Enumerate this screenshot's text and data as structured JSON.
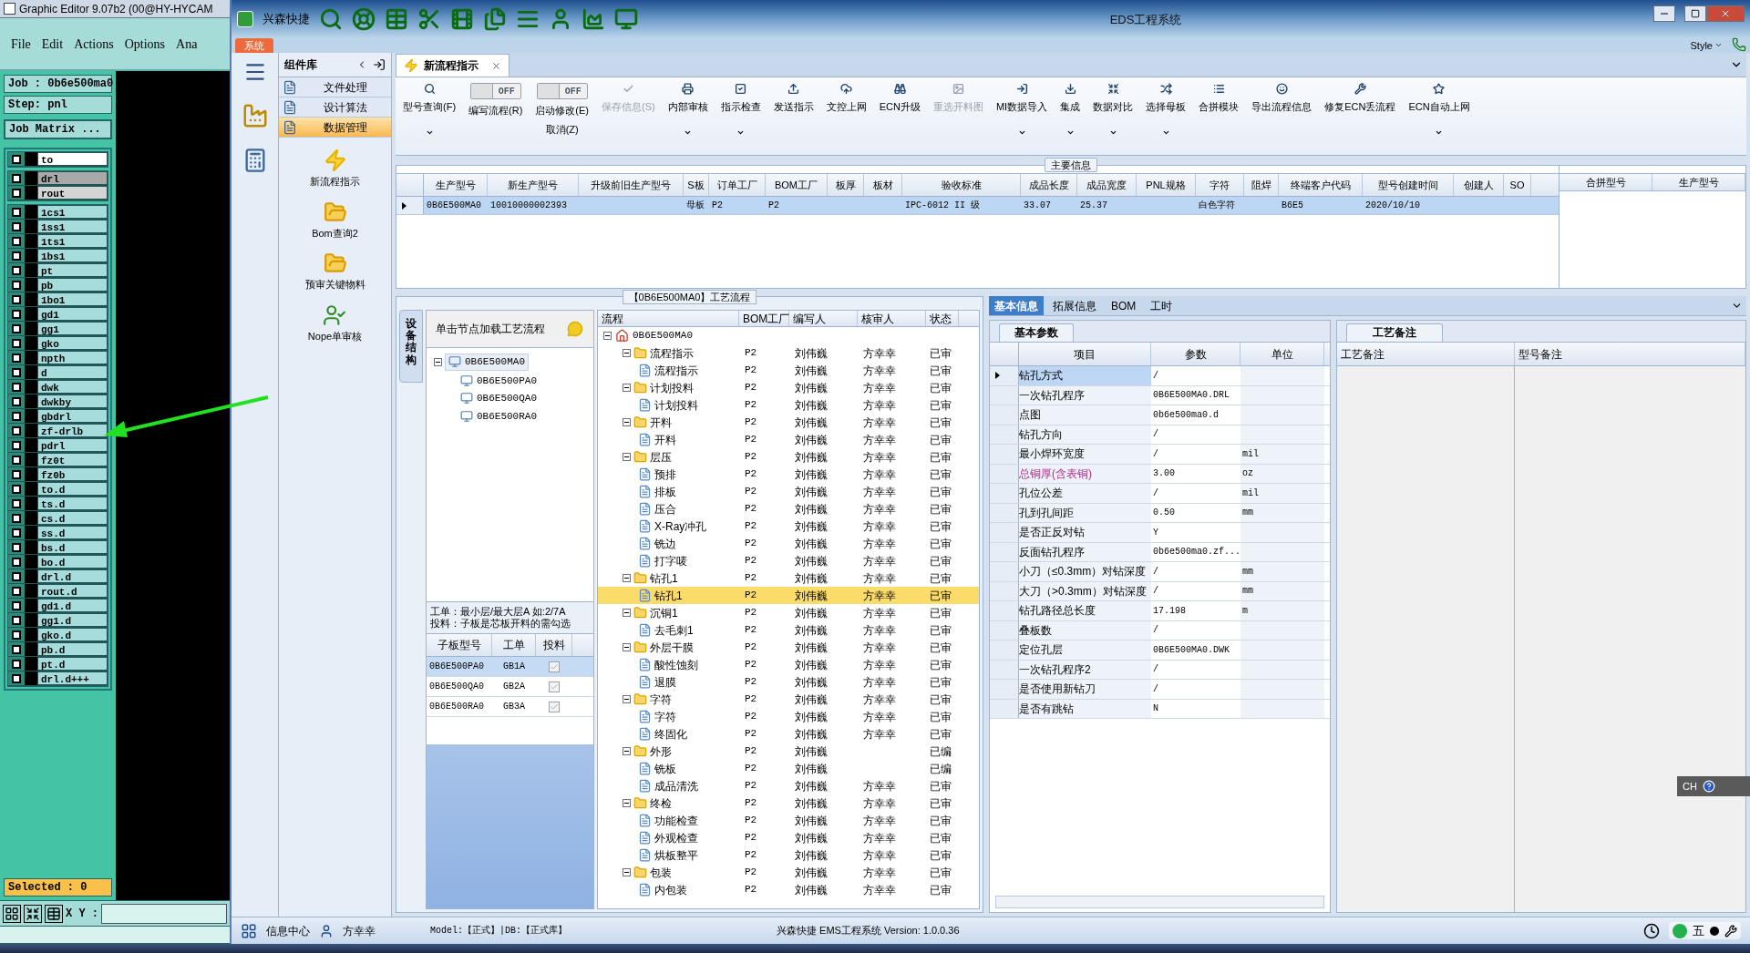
{
  "graphic_editor": {
    "title": "Graphic Editor 9.07b2 (00@HY-HYCAM",
    "menu": [
      "File",
      "Edit",
      "Actions",
      "Options",
      "Ana"
    ],
    "job": "Job : 0b6e500ma0",
    "step": "Step: pnl",
    "job_matrix_button": "Job Matrix ...",
    "layer_groups": [
      [
        {
          "name": "to",
          "color": "#ffffff",
          "checked": false
        }
      ],
      [
        {
          "name": "drl",
          "color": "#a9a9a9",
          "checked": false
        },
        {
          "name": "rout",
          "color": "#d4d4d4",
          "checked": false
        }
      ],
      [
        {
          "name": "1cs1",
          "color": "#a6dcdc",
          "checked": false
        },
        {
          "name": "1ss1",
          "color": "#a6dcdc",
          "checked": false
        },
        {
          "name": "1ts1",
          "color": "#a6dcdc",
          "checked": false
        },
        {
          "name": "1bs1",
          "color": "#a6dcdc",
          "checked": false
        },
        {
          "name": "pt",
          "color": "#a6dcdc",
          "checked": false
        },
        {
          "name": "pb",
          "color": "#a6dcdc",
          "checked": false
        },
        {
          "name": "1bo1",
          "color": "#a6dcdc",
          "checked": false
        },
        {
          "name": "gd1",
          "color": "#a6dcdc",
          "checked": false
        },
        {
          "name": "gg1",
          "color": "#a6dcdc",
          "checked": false
        },
        {
          "name": "gko",
          "color": "#a6dcdc",
          "checked": false
        },
        {
          "name": "npth",
          "color": "#a6dcdc",
          "checked": false
        },
        {
          "name": "d",
          "color": "#a6dcdc",
          "checked": false
        },
        {
          "name": "dwk",
          "color": "#a6dcdc",
          "checked": false
        },
        {
          "name": "dwkby",
          "color": "#a6dcdc",
          "checked": false
        },
        {
          "name": "gbdrl",
          "color": "#a6dcdc",
          "checked": false
        },
        {
          "name": "zf-drlb",
          "color": "#a6dcdc",
          "checked": false
        },
        {
          "name": "pdrl",
          "color": "#a6dcdc",
          "checked": false
        },
        {
          "name": "fz0t",
          "color": "#a6dcdc",
          "checked": false
        },
        {
          "name": "fz0b",
          "color": "#a6dcdc",
          "checked": false
        },
        {
          "name": "to.d",
          "color": "#a6dcdc",
          "checked": false
        },
        {
          "name": "ts.d",
          "color": "#a6dcdc",
          "checked": false
        },
        {
          "name": "cs.d",
          "color": "#a6dcdc",
          "checked": false
        },
        {
          "name": "ss.d",
          "color": "#a6dcdc",
          "checked": false
        },
        {
          "name": "bs.d",
          "color": "#a6dcdc",
          "checked": false
        },
        {
          "name": "bo.d",
          "color": "#a6dcdc",
          "checked": false
        },
        {
          "name": "drl.d",
          "color": "#a6dcdc",
          "checked": false
        },
        {
          "name": "rout.d",
          "color": "#a6dcdc",
          "checked": false
        },
        {
          "name": "gd1.d",
          "color": "#a6dcdc",
          "checked": false
        },
        {
          "name": "gg1.d",
          "color": "#a6dcdc",
          "checked": false
        },
        {
          "name": "gko.d",
          "color": "#a6dcdc",
          "checked": false
        },
        {
          "name": "pb.d",
          "color": "#a6dcdc",
          "checked": false
        },
        {
          "name": "pt.d",
          "color": "#a6dcdc",
          "checked": false
        },
        {
          "name": "drl.d+++",
          "color": "#a6dcdc",
          "checked": false
        }
      ]
    ],
    "selected": "Selected : 0",
    "xy_label": "X Y :"
  },
  "eds": {
    "app_name": "兴森快捷",
    "title": "EDS工程系统",
    "menu_tab": "系统",
    "style_menu": "Style",
    "sidebar": {
      "title": "组件库",
      "items": [
        {
          "label": "文件处理",
          "selected": false
        },
        {
          "label": "设计算法",
          "selected": false
        },
        {
          "label": "数据管理",
          "selected": true
        }
      ],
      "tools": [
        "新流程指示",
        "Bom查询2",
        "预审关键物料",
        "Nope单审核"
      ]
    },
    "doc_tab": "新流程指示",
    "ribbon": [
      {
        "kind": "button",
        "label": "型号查询(F)",
        "disabled": false,
        "dropdown": true
      },
      {
        "kind": "toggle",
        "label": "编写流程(R)",
        "toggle_text": "OFF",
        "on": false
      },
      {
        "kind": "toggle",
        "label": "启动修改(E)",
        "sub_label": "取消(Z)",
        "toggle_text": "OFF",
        "on": false
      },
      {
        "kind": "button",
        "label": "保存信息(S)",
        "disabled": true,
        "dropdown": false
      },
      {
        "kind": "button",
        "label": "内部审核",
        "disabled": false,
        "dropdown": true
      },
      {
        "kind": "button",
        "label": "指示检查",
        "disabled": false,
        "dropdown": true
      },
      {
        "kind": "button",
        "label": "发送指示",
        "disabled": false,
        "dropdown": false
      },
      {
        "kind": "button",
        "label": "文控上网",
        "disabled": false,
        "dropdown": false
      },
      {
        "kind": "button",
        "label": "ECN升级",
        "disabled": false,
        "dropdown": false
      },
      {
        "kind": "button",
        "label": "重选开料图",
        "disabled": true,
        "dropdown": false
      },
      {
        "kind": "button",
        "label": "MI数据导入",
        "disabled": false,
        "dropdown": true
      },
      {
        "kind": "button",
        "label": "集成",
        "disabled": false,
        "dropdown": true
      },
      {
        "kind": "button",
        "label": "数据对比",
        "disabled": false,
        "dropdown": true
      },
      {
        "kind": "button",
        "label": "选择母板",
        "disabled": false,
        "dropdown": true
      },
      {
        "kind": "button",
        "label": "合拼模块",
        "disabled": false,
        "dropdown": false
      },
      {
        "kind": "button",
        "label": "导出流程信息",
        "disabled": false,
        "dropdown": false
      },
      {
        "kind": "button",
        "label": "修复ECN丢流程",
        "disabled": false,
        "dropdown": false
      },
      {
        "kind": "button",
        "label": "ECN自动上网",
        "disabled": false,
        "dropdown": true
      }
    ],
    "main_info": {
      "title": "主要信息",
      "columns": [
        "生产型号",
        "新生产型号",
        "升级前旧生产型号",
        "S板",
        "订单工厂",
        "BOM工厂",
        "板厚",
        "板材",
        "验收标准",
        "成品长度",
        "成品宽度",
        "PNL规格",
        "字符",
        "阻焊",
        "终端客户代码",
        "型号创建时间",
        "创建人",
        "SO"
      ],
      "rows": [
        {
          "selected": true,
          "cells": [
            "0B6E500MA0",
            "10010000002393",
            null,
            "母板",
            "P2",
            "P2",
            null,
            null,
            "IPC-6012 II 级",
            "33.07",
            "25.37",
            null,
            "白色字符",
            null,
            "B6E5",
            "2020/10/10",
            null,
            null
          ]
        }
      ],
      "side_columns": [
        "合拼型号",
        "生产型号"
      ]
    },
    "process": {
      "title": "【0B6E500MA0】工艺流程",
      "side_tab": "设备结构",
      "tree_hint": "单击节点加载工艺流程",
      "structure_tree": {
        "label": "0B6E500MA0",
        "selected": true,
        "expanded": true,
        "children": [
          {
            "label": "0B6E500PA0",
            "selected": false
          },
          {
            "label": "0B6E500QA0",
            "selected": false
          },
          {
            "label": "0B6E500RA0",
            "selected": false
          }
        ]
      },
      "notes": [
        "工单：最小层/最大层A 如:2/7A",
        "投料：子板是芯板开料的需勾选"
      ],
      "sub_boards": {
        "columns": [
          "子板型号",
          "工单",
          "投料"
        ],
        "rows": [
          {
            "model": "0B6E500PA0",
            "order": "GB1A",
            "checked": true,
            "selected": true
          },
          {
            "model": "0B6E500QA0",
            "order": "GB2A",
            "checked": true,
            "selected": false
          },
          {
            "model": "0B6E500RA0",
            "order": "GB3A",
            "checked": true,
            "selected": false
          }
        ]
      },
      "grid_columns": [
        "流程",
        "BOM工厂",
        "编写人",
        "核审人",
        "状态"
      ],
      "root": {
        "label": "0B6E500MA0",
        "expanded": true
      },
      "steps": [
        {
          "name": "流程指示",
          "bom": "P2",
          "writer": "刘伟巍",
          "reviewer": "方幸幸",
          "status": "已审",
          "selected": false,
          "expanded": true,
          "children": [
            {
              "name": "流程指示",
              "bom": "P2",
              "writer": "刘伟巍",
              "reviewer": "方幸幸",
              "status": "已审",
              "selected": false
            }
          ]
        },
        {
          "name": "计划投料",
          "bom": "P2",
          "writer": "刘伟巍",
          "reviewer": "方幸幸",
          "status": "已审",
          "selected": false,
          "expanded": true,
          "children": [
            {
              "name": "计划投料",
              "bom": "P2",
              "writer": "刘伟巍",
              "reviewer": "方幸幸",
              "status": "已审",
              "selected": false
            }
          ]
        },
        {
          "name": "开料",
          "bom": "P2",
          "writer": "刘伟巍",
          "reviewer": "方幸幸",
          "status": "已审",
          "selected": false,
          "expanded": true,
          "children": [
            {
              "name": "开料",
              "bom": "P2",
              "writer": "刘伟巍",
              "reviewer": "方幸幸",
              "status": "已审",
              "selected": false
            }
          ]
        },
        {
          "name": "层压",
          "bom": "P2",
          "writer": "刘伟巍",
          "reviewer": "方幸幸",
          "status": "已审",
          "selected": false,
          "expanded": true,
          "children": [
            {
              "name": "预排",
              "bom": "P2",
              "writer": "刘伟巍",
              "reviewer": "方幸幸",
              "status": "已审",
              "selected": false
            },
            {
              "name": "排板",
              "bom": "P2",
              "writer": "刘伟巍",
              "reviewer": "方幸幸",
              "status": "已审",
              "selected": false
            },
            {
              "name": "压合",
              "bom": "P2",
              "writer": "刘伟巍",
              "reviewer": "方幸幸",
              "status": "已审",
              "selected": false
            },
            {
              "name": "X-Ray冲孔",
              "bom": "P2",
              "writer": "刘伟巍",
              "reviewer": "方幸幸",
              "status": "已审",
              "selected": false
            },
            {
              "name": "铣边",
              "bom": "P2",
              "writer": "刘伟巍",
              "reviewer": "方幸幸",
              "status": "已审",
              "selected": false
            },
            {
              "name": "打字唛",
              "bom": "P2",
              "writer": "刘伟巍",
              "reviewer": "方幸幸",
              "status": "已审",
              "selected": false
            }
          ]
        },
        {
          "name": "钻孔1",
          "bom": "P2",
          "writer": "刘伟巍",
          "reviewer": "方幸幸",
          "status": "已审",
          "selected": false,
          "expanded": true,
          "children": [
            {
              "name": "钻孔1",
              "bom": "P2",
              "writer": "刘伟巍",
              "reviewer": "方幸幸",
              "status": "已审",
              "selected": true
            }
          ]
        },
        {
          "name": "沉铜1",
          "bom": "P2",
          "writer": "刘伟巍",
          "reviewer": "方幸幸",
          "status": "已审",
          "selected": false,
          "expanded": true,
          "children": [
            {
              "name": "去毛刺1",
              "bom": "P2",
              "writer": "刘伟巍",
              "reviewer": "方幸幸",
              "status": "已审",
              "selected": false
            }
          ]
        },
        {
          "name": "外层干膜",
          "bom": "P2",
          "writer": "刘伟巍",
          "reviewer": "方幸幸",
          "status": "已审",
          "selected": false,
          "expanded": true,
          "children": [
            {
              "name": "酸性蚀刻",
              "bom": "P2",
              "writer": "刘伟巍",
              "reviewer": "方幸幸",
              "status": "已审",
              "selected": false
            },
            {
              "name": "退膜",
              "bom": "P2",
              "writer": "刘伟巍",
              "reviewer": "方幸幸",
              "status": "已审",
              "selected": false
            }
          ]
        },
        {
          "name": "字符",
          "bom": "P2",
          "writer": "刘伟巍",
          "reviewer": "方幸幸",
          "status": "已审",
          "selected": false,
          "expanded": true,
          "children": [
            {
              "name": "字符",
              "bom": "P2",
              "writer": "刘伟巍",
              "reviewer": "方幸幸",
              "status": "已审",
              "selected": false
            },
            {
              "name": "终固化",
              "bom": "P2",
              "writer": "刘伟巍",
              "reviewer": "方幸幸",
              "status": "已审",
              "selected": false
            }
          ]
        },
        {
          "name": "外形",
          "bom": "P2",
          "writer": "刘伟巍",
          "status": "已编",
          "selected": false,
          "expanded": true,
          "children": [
            {
              "name": "铣板",
              "bom": "P2",
              "writer": "刘伟巍",
              "status": "已编",
              "selected": false
            },
            {
              "name": "成品清洗",
              "bom": "P2",
              "writer": "刘伟巍",
              "reviewer": "方幸幸",
              "status": "已审",
              "selected": false
            }
          ]
        },
        {
          "name": "终检",
          "bom": "P2",
          "writer": "刘伟巍",
          "reviewer": "方幸幸",
          "status": "已审",
          "selected": false,
          "expanded": true,
          "children": [
            {
              "name": "功能检查",
              "bom": "P2",
              "writer": "刘伟巍",
              "reviewer": "方幸幸",
              "status": "已审",
              "selected": false
            },
            {
              "name": "外观检查",
              "bom": "P2",
              "writer": "刘伟巍",
              "reviewer": "方幸幸",
              "status": "已审",
              "selected": false
            },
            {
              "name": "烘板整平",
              "bom": "P2",
              "writer": "刘伟巍",
              "reviewer": "方幸幸",
              "status": "已审",
              "selected": false
            }
          ]
        },
        {
          "name": "包装",
          "bom": "P2",
          "writer": "刘伟巍",
          "reviewer": "方幸幸",
          "status": "已审",
          "selected": false,
          "expanded": true,
          "children": [
            {
              "name": "内包装",
              "bom": "P2",
              "writer": "刘伟巍",
              "reviewer": "方幸幸",
              "status": "已审",
              "selected": false
            }
          ]
        }
      ]
    },
    "details": {
      "tabs": [
        {
          "label": "基本信息",
          "selected": true
        },
        {
          "label": "拓展信息",
          "selected": false
        },
        {
          "label": "BOM",
          "selected": false
        },
        {
          "label": "工时",
          "selected": false
        }
      ],
      "params_tab": "基本参数",
      "params_columns": [
        "项目",
        "参数",
        "单位"
      ],
      "params": [
        {
          "item": "钻孔方式",
          "value": "/",
          "selected": true,
          "emphasis": false
        },
        {
          "item": "一次钻孔程序",
          "value": "0B6E500MA0.DRL",
          "selected": false,
          "emphasis": false
        },
        {
          "item": "点图",
          "value": "0b6e500ma0.d",
          "selected": false,
          "emphasis": false
        },
        {
          "item": "钻孔方向",
          "value": "/",
          "selected": false,
          "emphasis": false
        },
        {
          "item": "最小焊环宽度",
          "value": "/",
          "unit": "mil",
          "selected": false,
          "emphasis": false
        },
        {
          "item": "总铜厚(含表铜)",
          "value": "3.00",
          "unit": "oz",
          "selected": false,
          "emphasis": true
        },
        {
          "item": "孔位公差",
          "value": "/",
          "unit": "mil",
          "selected": false,
          "emphasis": false
        },
        {
          "item": "孔到孔间距",
          "value": "0.50",
          "unit": "mm",
          "selected": false,
          "emphasis": false
        },
        {
          "item": "是否正反对钻",
          "value": "Y",
          "selected": false,
          "emphasis": false
        },
        {
          "item": "反面钻孔程序",
          "value": "0b6e500ma0.zf...",
          "selected": false,
          "emphasis": false
        },
        {
          "item": "小刀（≤0.3mm）对钻深度",
          "value": "/",
          "unit": "mm",
          "selected": false,
          "emphasis": false
        },
        {
          "item": "大刀（>0.3mm）对钻深度",
          "value": "/",
          "unit": "mm",
          "selected": false,
          "emphasis": false
        },
        {
          "item": "钻孔路径总长度",
          "value": "17.198",
          "unit": "m",
          "selected": false,
          "emphasis": false
        },
        {
          "item": "叠板数",
          "value": "/",
          "selected": false,
          "emphasis": false
        },
        {
          "item": "定位孔层",
          "value": "0B6E500MA0.DWK",
          "selected": false,
          "emphasis": false
        },
        {
          "item": "一次钻孔程序2",
          "value": "/",
          "selected": false,
          "emphasis": false
        },
        {
          "item": "是否使用新钻刀",
          "value": "/",
          "selected": false,
          "emphasis": false
        },
        {
          "item": "是否有跳钻",
          "value": "N",
          "selected": false,
          "emphasis": false
        }
      ],
      "remarks_tab": "工艺备注",
      "remarks_columns": [
        "工艺备注",
        "型号备注"
      ]
    },
    "status_bar": {
      "info_center": "信息中心",
      "user": "方幸幸",
      "model": "Model:【正式】|DB:【正式库】",
      "version": "兴森快捷 EMS工程系统 Version: 1.0.0.36"
    },
    "ime": {
      "language": "CH",
      "tray_input": "五"
    }
  }
}
